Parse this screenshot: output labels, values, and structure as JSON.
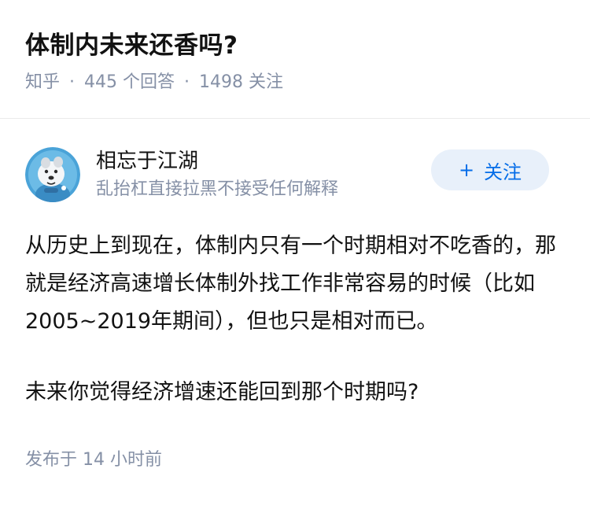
{
  "question": {
    "title": "体制内未来还香吗?",
    "source": "知乎",
    "answer_count": "445 个回答",
    "follower_count": "1498 关注"
  },
  "answer": {
    "author": {
      "name": "相忘于江湖",
      "bio": "乱抬杠直接拉黑不接受任何解释",
      "avatar_icon": "husky-dog-avatar"
    },
    "follow_button": {
      "icon": "+",
      "label": "关注"
    },
    "paragraphs": [
      "从历史上到现在，体制内只有一个时期相对不吃香的，那就是经济高速增长体制外找工作非常容易的时候（比如2005~2019年期间），但也只是相对而已。",
      "未来你觉得经济增速还能回到那个时期吗?"
    ],
    "published": "发布于 14 小时前"
  },
  "colors": {
    "accent": "#056de8",
    "follow_bg": "#e8f0fa",
    "meta_text": "#8590a6",
    "body_text": "#121212"
  }
}
